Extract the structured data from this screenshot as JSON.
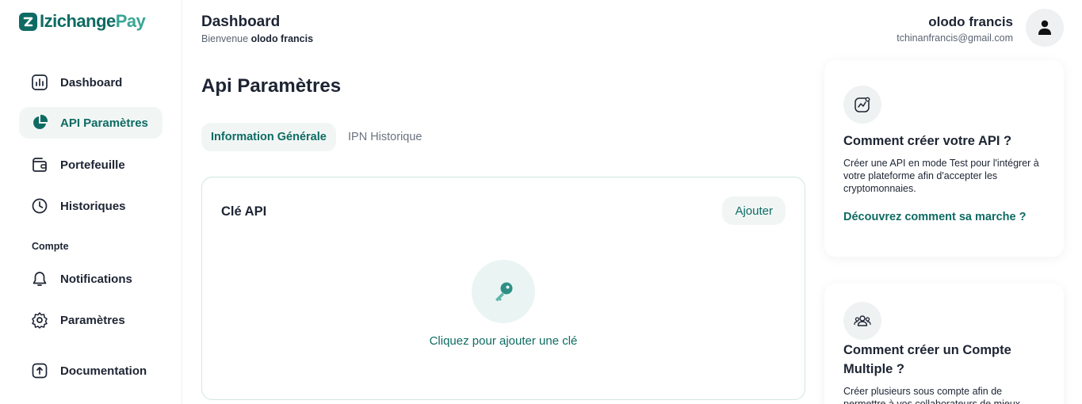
{
  "brand": {
    "name_part1": "Izichange",
    "name_part2": "Pay",
    "primary_color": "#0e6b63",
    "accent_color": "#3aa596"
  },
  "sidebar": {
    "items": [
      {
        "label": "Dashboard",
        "icon": "bar-chart-icon"
      },
      {
        "label": "API Paramètres",
        "icon": "pie-chart-icon",
        "active": true
      },
      {
        "label": "Portefeuille",
        "icon": "wallet-icon"
      },
      {
        "label": "Historiques",
        "icon": "clock-icon"
      },
      {
        "label": "Notifications",
        "icon": "bell-icon"
      },
      {
        "label": "Paramètres",
        "icon": "gear-icon"
      },
      {
        "label": "Documentation",
        "icon": "upload-doc-icon"
      }
    ],
    "section_label": "Compte"
  },
  "header": {
    "title": "Dashboard",
    "welcome": "Bienvenue",
    "welcome_name": "olodo francis",
    "user_name": "olodo francis",
    "user_email": "tchinanfrancis@gmail.com"
  },
  "main": {
    "page_title": "Api Paramètres",
    "tabs": [
      {
        "label": "Information Générale",
        "active": true
      },
      {
        "label": "IPN Historique",
        "active": false
      }
    ],
    "card": {
      "title": "Clé API",
      "add_label": "Ajouter",
      "empty_text": "Cliquez pour ajouter une clé"
    }
  },
  "right": {
    "cards": [
      {
        "title": "Comment créer votre API ?",
        "desc": "Créer une API en mode Test pour l'intégrer à votre plateforme afin d'accepter les cryptomonnaies.",
        "link": "Découvrez comment sa marche ?"
      },
      {
        "title": "Comment créer un Compte Multiple ?",
        "desc": "Créer plusieurs sous compte afin de permettre à vos collaborateurs de mieux"
      }
    ]
  }
}
